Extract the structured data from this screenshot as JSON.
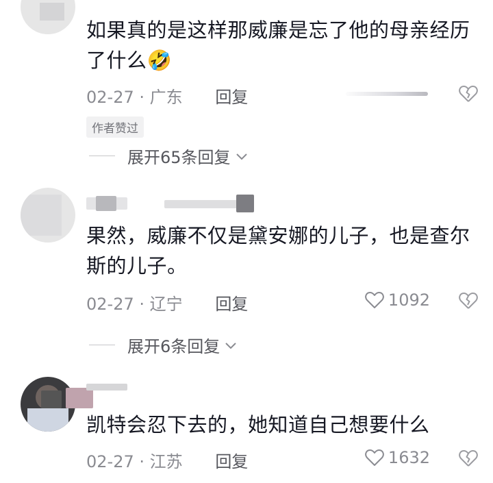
{
  "comments": [
    {
      "text": "如果真的是这样那威廉是忘了他的母亲经历了什么",
      "emoji": "🤣",
      "date": "02-27",
      "location": "广东",
      "reply_label": "回复",
      "author_badge": "作者赞过",
      "expand_label": "展开65条回复",
      "like_count": ""
    },
    {
      "text": "果然，威廉不仅是黛安娜的儿子，也是查尔斯的儿子。",
      "date": "02-27",
      "location": "辽宁",
      "reply_label": "回复",
      "like_count": "1092",
      "expand_label": "展开6条回复"
    },
    {
      "text": "凯特会忍下去的，她知道自己想要什么",
      "date": "02-27",
      "location": "江苏",
      "reply_label": "回复",
      "like_count": "1632"
    }
  ],
  "separator": "·",
  "icons": {
    "like": "heart-outline-icon",
    "dislike": "broken-heart-icon",
    "expand": "chevron-down-icon"
  },
  "colors": {
    "text": "#161823",
    "meta": "#8a8b91",
    "badge_bg": "#f1f1f2"
  }
}
